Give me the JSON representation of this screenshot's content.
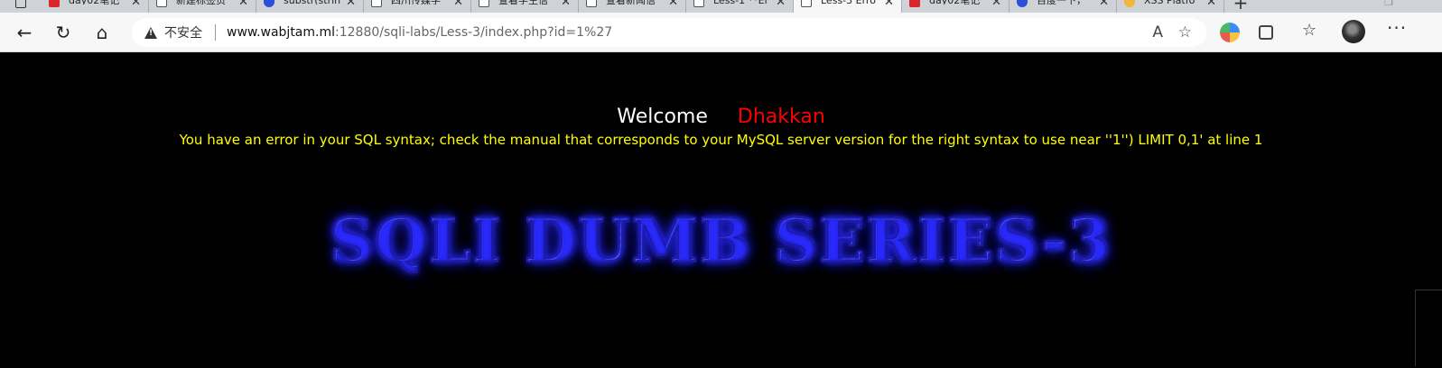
{
  "tabs": [
    {
      "title": "day02笔记",
      "icon": "pdf-icon"
    },
    {
      "title": "新建标签页",
      "icon": "page-icon"
    },
    {
      "title": "substr(strin",
      "icon": "baidu-icon"
    },
    {
      "title": "四川传媒学",
      "icon": "page-icon"
    },
    {
      "title": "查看学生信",
      "icon": "page-icon"
    },
    {
      "title": "查看新闻信",
      "icon": "page-icon"
    },
    {
      "title": "Less-1 **Er",
      "icon": "page-icon"
    },
    {
      "title": "Less-3 Erro",
      "icon": "page-icon",
      "active": true
    },
    {
      "title": "day02笔记",
      "icon": "pdf-icon"
    },
    {
      "title": "百度一下，",
      "icon": "baidu-icon"
    },
    {
      "title": "XSS Platfo",
      "icon": "xss-icon"
    }
  ],
  "address_bar": {
    "security_label": "不安全",
    "url_host": "www.wabjtam.ml",
    "url_rest": ":12880/sqli-labs/Less-3/index.php?id=1%27"
  },
  "page": {
    "welcome": "Welcome",
    "name": "Dhakkan",
    "error": "You have an error in your SQL syntax; check the manual that corresponds to your MySQL server version for the right syntax to use near ''1'') LIMIT 0,1' at line 1",
    "banner": "SQLI DUMB SERIES-3"
  },
  "colors": {
    "welcome": "#ffffff",
    "name": "#ff0000",
    "error": "#ffff00",
    "background": "#000000"
  }
}
